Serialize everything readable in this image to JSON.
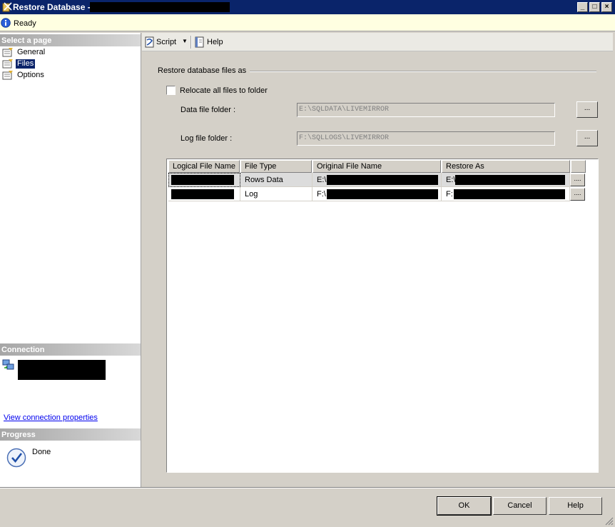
{
  "window": {
    "title": "Restore Database -",
    "controls": {
      "minimize": "_",
      "maximize": "□",
      "close": "×"
    }
  },
  "status": {
    "text": "Ready",
    "icon": "info-icon"
  },
  "left_pane": {
    "select_page_header": "Select a page",
    "pages": [
      {
        "label": "General",
        "selected": false
      },
      {
        "label": "Files",
        "selected": true
      },
      {
        "label": "Options",
        "selected": false
      }
    ],
    "connection_header": "Connection",
    "connection_link": "View connection properties",
    "progress_header": "Progress",
    "progress_status": "Done"
  },
  "toolbar": {
    "script_label": "Script",
    "help_label": "Help"
  },
  "files": {
    "group_label": "Restore database files as",
    "relocate_label": "Relocate all files to folder",
    "relocate_checked": false,
    "data_folder_label": "Data file folder :",
    "data_folder_value": "E:\\SQLDATA\\LIVEMIRROR",
    "log_folder_label": "Log file folder :",
    "log_folder_value": "F:\\SQLLOGS\\LIVEMIRROR",
    "browse_label": "..."
  },
  "grid": {
    "columns": [
      "Logical File Name",
      "File Type",
      "Original File Name",
      "Restore As"
    ],
    "rows": [
      {
        "file_type": "Rows Data",
        "original_prefix": "E:\\",
        "restore_prefix": "E:\\"
      },
      {
        "file_type": "Log",
        "original_prefix": "F:\\",
        "restore_prefix": "F:"
      }
    ],
    "cell_button": "...."
  },
  "buttons": {
    "ok": "OK",
    "cancel": "Cancel",
    "help": "Help"
  }
}
